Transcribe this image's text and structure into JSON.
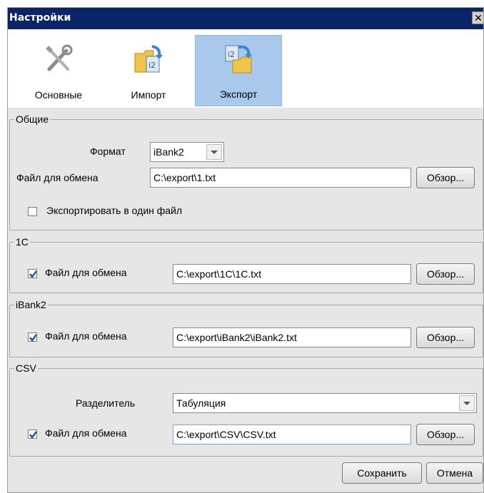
{
  "window": {
    "title": "Настройки",
    "close_glyph": "✕"
  },
  "toolbar": {
    "items": [
      {
        "label": "Основные",
        "icon": "tools-icon",
        "active": false
      },
      {
        "label": "Импорт",
        "icon": "import-icon",
        "active": false
      },
      {
        "label": "Экспорт",
        "icon": "export-icon",
        "active": true
      }
    ]
  },
  "general": {
    "legend": "Общие",
    "format_label": "Формат",
    "format_value": "iBank2",
    "file_label": "Файл для обмена",
    "file_value": "C:\\export\\1.txt",
    "browse_label": "Обзор...",
    "single_file_label": "Экспортировать в один файл",
    "single_file_checked": false
  },
  "onec": {
    "legend": "1С",
    "file_label": "Файл для обмена",
    "file_checked": true,
    "file_value": "C:\\export\\1C\\1C.txt",
    "browse_label": "Обзор..."
  },
  "ibank2": {
    "legend": "iBank2",
    "file_label": "Файл для обмена",
    "file_checked": true,
    "file_value": "C:\\export\\iBank2\\iBank2.txt",
    "browse_label": "Обзор..."
  },
  "csv": {
    "legend": "CSV",
    "separator_label": "Разделитель",
    "separator_value": "Табуляция",
    "file_label": "Файл для обмена",
    "file_checked": true,
    "file_value": "C:\\export\\CSV\\CSV.txt",
    "browse_label": "Обзор..."
  },
  "footer": {
    "save_label": "Сохранить",
    "cancel_label": "Отмена"
  }
}
